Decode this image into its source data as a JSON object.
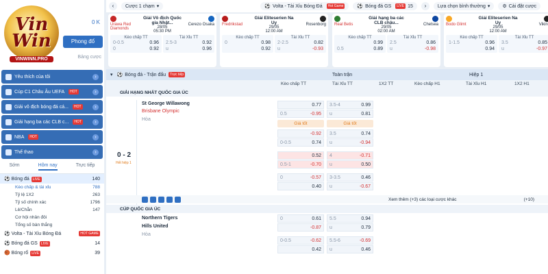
{
  "brand": {
    "logo_text_1": "Vin",
    "logo_text_2": "Win",
    "logo_sub": "VINWINN.PRO"
  },
  "account": {
    "balance": "0 K",
    "deposit": "Phong đổ",
    "bet_slip": "Bảng cược"
  },
  "topbar": {
    "tab": "Cược 1 chạm",
    "pill1_label": "Volta - Tài Xỉu Bóng Đá",
    "pill1_badge": "Hot Game",
    "pill2_label": "Bóng đá GS",
    "pill2_badge": "LIVE",
    "pill2_count": "15",
    "sort": "Lựa chọn bình thường",
    "settings": "Cài đặt cược"
  },
  "cards": [
    {
      "home": "Urawa Red Diamonds",
      "away": "Cerezo Osaka",
      "league": "Giải Vô địch Quốc gia Nhật...",
      "date": "28/05",
      "time": "05:30 PM",
      "hc_title": "Kèo chấp TT",
      "ou_title": "Tài Xỉu TT",
      "hc": [
        [
          "0-0.5",
          "0.96"
        ],
        [
          "0",
          "0.92"
        ]
      ],
      "ou": [
        [
          "2.5-3",
          "0.92"
        ],
        [
          "u",
          "0.96"
        ]
      ]
    },
    {
      "home": "Fredrikstad",
      "away": "Rosenborg",
      "league": "Giải Eliteserien Na Uy",
      "date": "29/05",
      "time": "12:00 AM",
      "hc_title": "Kèo chấp TT",
      "ou_title": "Tài Xỉu TT",
      "hc": [
        [
          "0",
          "0.98"
        ],
        [
          "",
          "0.92"
        ]
      ],
      "ou": [
        [
          "2-2.5",
          "0.82"
        ],
        [
          "u",
          "-0.93"
        ]
      ]
    },
    {
      "home": "Real Betis",
      "away": "Chelsea",
      "league": "Giải hạng ba các CLB châu...",
      "date": "29/05",
      "time": "02:00 AM",
      "hc_title": "Kèo chấp TT",
      "ou_title": "Tài Xỉu TT",
      "hc": [
        [
          "",
          "0.99"
        ],
        [
          "0.5",
          "0.89"
        ]
      ],
      "ou": [
        [
          "2.5",
          "0.86"
        ],
        [
          "u",
          "-0.98"
        ]
      ]
    },
    {
      "home": "Bodo Glimt",
      "away": "Viking",
      "league": "Giải Eliteserien Na Uy",
      "date": "29/05",
      "time": "12:00 AM",
      "hc_title": "Kèo chấp TT",
      "ou_title": "Tài Xỉu TT",
      "hc": [
        [
          "1-1.5",
          "0.96"
        ],
        [
          "",
          "0.94"
        ]
      ],
      "ou": [
        [
          "3.5",
          "0.85"
        ],
        [
          "u",
          "-0.97"
        ]
      ]
    }
  ],
  "sidebar": {
    "items": [
      {
        "label": "Yêu thích của tôi",
        "hot": ""
      },
      {
        "label": "Cúp C1 Châu Âu UEFA",
        "hot": "HOT"
      },
      {
        "label": "Giải vô địch bóng đá cá...",
        "hot": "HOT"
      },
      {
        "label": "Giải hạng ba các CLB c...",
        "hot": "HOT"
      },
      {
        "label": "NBA",
        "hot": "HOT"
      },
      {
        "label": "Thể thao",
        "hot": ""
      }
    ],
    "tabs": [
      "Sớm",
      "Hôm nay",
      "Trực tiếp"
    ],
    "sports": [
      {
        "label": "Bóng đá",
        "badge": "LIVE",
        "count": "140"
      },
      {
        "label": "Kèo chấp & tài xỉu",
        "count": "788"
      },
      {
        "label": "Tỷ lệ 1X2",
        "count": "263"
      },
      {
        "label": "Tỷ số chính xác",
        "count": "1796"
      },
      {
        "label": "Lẻ/Chẵn",
        "count": "147"
      },
      {
        "label": "Cơ hội nhân đôi",
        "count": ""
      },
      {
        "label": "Tổng số bàn thắng",
        "count": ""
      },
      {
        "label": "Volta - Tài Xỉu Bóng Đá",
        "badge": "HOT GAME",
        "count": ""
      },
      {
        "label": "Bóng đá GS",
        "badge": "LIVE",
        "count": "14"
      },
      {
        "label": "Bóng rổ",
        "badge": "LIVE",
        "count": "39"
      }
    ]
  },
  "table": {
    "head": {
      "sport": "Bóng đá - Trận đấu",
      "live": "Trực tiếp",
      "full": "Toàn trận",
      "half": "Hiệp 1"
    },
    "cols": {
      "hc": "Kèo chấp TT",
      "ou": "Tài Xỉu TT",
      "x12": "1X2 TT",
      "hc1": "Kèo chấp H1",
      "ou1": "Tài Xỉu H1",
      "x121": "1X2 H1"
    },
    "league1": "GIẢI HẠNG NHẤT QUỐC GIA ÚC",
    "match1": {
      "home": "St George Willawong",
      "away": "Brisbane Olympic",
      "draw": "Hòa",
      "score": "0 - 2",
      "period": "Hết hiệp 1"
    },
    "best": "Giá tốt",
    "rows1": [
      {
        "hc": [
          [
            "",
            "0.77"
          ],
          [
            "0.5",
            "-0.95"
          ]
        ],
        "ou": [
          [
            "3.5-4",
            "0.99"
          ],
          [
            "u",
            "0.81"
          ]
        ]
      },
      {
        "hc": [
          [
            "",
            "-0.92"
          ],
          [
            "0-0.5",
            "0.74"
          ]
        ],
        "ou": [
          [
            "3.5",
            "0.74"
          ],
          [
            "u",
            "-0.94"
          ]
        ]
      },
      {
        "hc": [
          [
            "",
            "0.52"
          ],
          [
            "0.5-1",
            "-0.70"
          ]
        ],
        "ou": [
          [
            "4",
            "-0.71"
          ],
          [
            "u",
            "0.50"
          ]
        ]
      },
      {
        "hc": [
          [
            "0",
            "-0.57"
          ],
          [
            "",
            "0.40"
          ]
        ],
        "ou": [
          [
            "3-3.5",
            "0.46"
          ],
          [
            "u",
            "-0.67"
          ]
        ]
      }
    ],
    "more": "Xem thêm (+3) các loại cược khác",
    "more_count": "(+10)",
    "league2": "CÚP QUỐC GIA ÚC",
    "match2": {
      "home": "Northern Tigers",
      "away": "Hills United",
      "draw": "Hòa"
    },
    "rows2": [
      {
        "hc": [
          [
            "0",
            "0.61"
          ],
          [
            "",
            "-0.87"
          ]
        ],
        "ou": [
          [
            "5.5",
            "0.94"
          ],
          [
            "u",
            "0.79"
          ]
        ]
      },
      {
        "hc": [
          [
            "0-0.5",
            "-0.62"
          ],
          [
            "",
            "0.42"
          ]
        ],
        "ou": [
          [
            "5.5-6",
            "-0.69"
          ],
          [
            "u",
            "0.46"
          ]
        ]
      }
    ]
  }
}
